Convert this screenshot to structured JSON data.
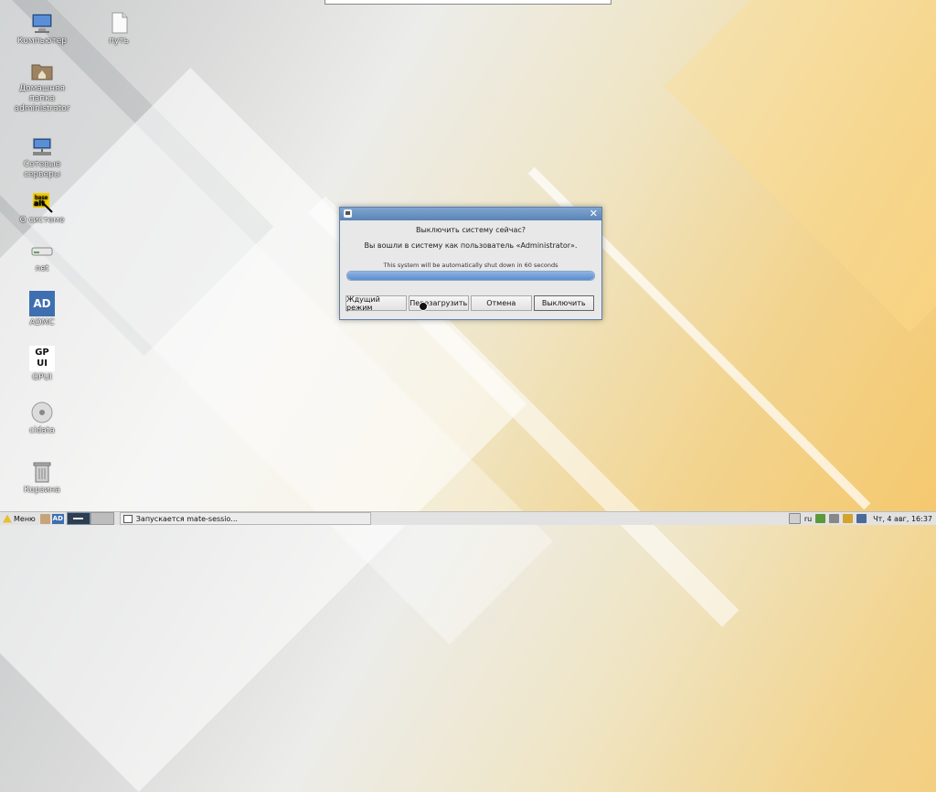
{
  "desktop": {
    "icons": [
      {
        "label": "Компьютер"
      },
      {
        "label": "путь"
      },
      {
        "label": "Домашняя папка administrator"
      },
      {
        "label": "Сетевые серверы"
      },
      {
        "label": "О системе"
      },
      {
        "label": "net"
      },
      {
        "label": "ADMC",
        "glyph_text": "AD"
      },
      {
        "label": "GPUI",
        "glyph_text": "GP UI"
      },
      {
        "label": "cidata"
      },
      {
        "label": "Корзина"
      }
    ]
  },
  "dialog": {
    "question": "Выключить систему сейчас?",
    "message": "Вы вошли в систему как пользователь «Administrator».",
    "countdown": "This system will be automatically shut down in 60 seconds",
    "progress_fraction": 1.0,
    "buttons": {
      "sleep": "Ждущий режим",
      "reboot": "Перезагрузить",
      "cancel": "Отмена",
      "shutdown": "Выключить"
    }
  },
  "panel": {
    "menu_label": "Меню",
    "ad_label": "AD",
    "task_label": "Запускается mate-sessio...",
    "keyboard_layout": "ru",
    "clock": "Чт, 4 авг, 16:37"
  },
  "colors": {
    "dialog_titlebar": "#5a83b6",
    "progress": "#5b8ecd",
    "panel_bg": "#e2e2e2"
  }
}
